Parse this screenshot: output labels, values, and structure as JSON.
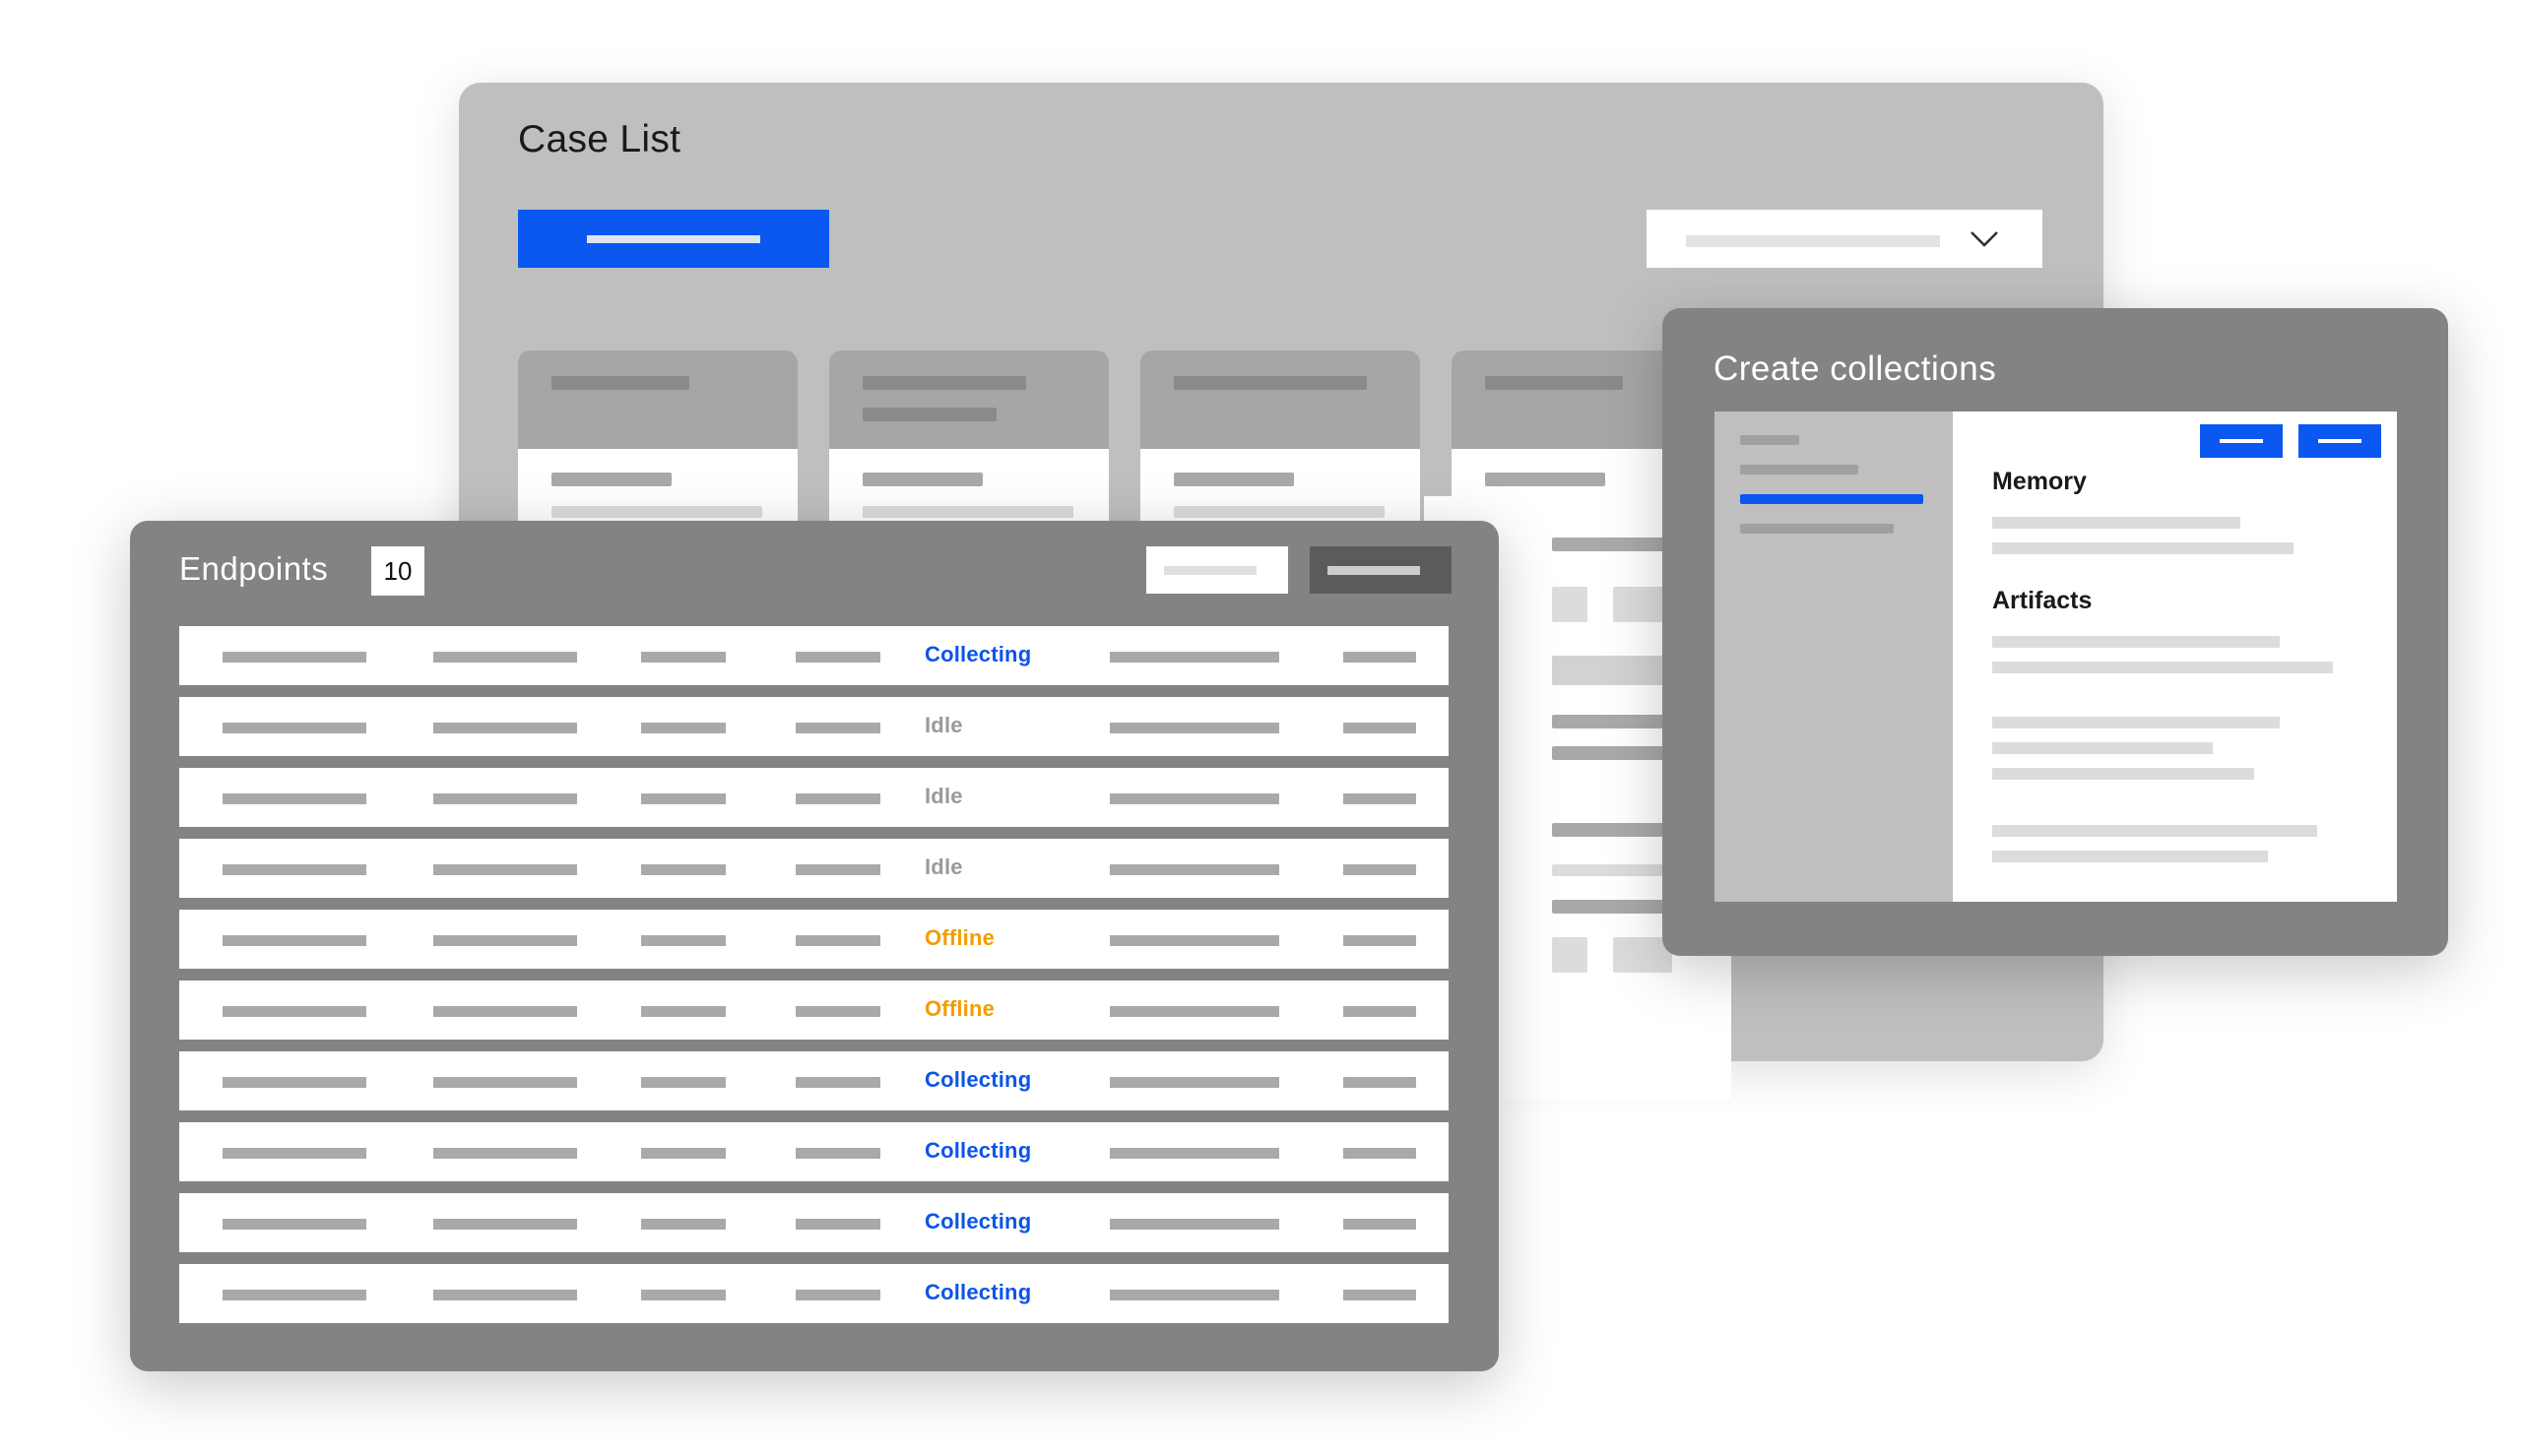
{
  "case_list": {
    "title": "Case List"
  },
  "endpoints": {
    "title": "Endpoints",
    "count": "10",
    "rows": [
      {
        "status": "Collecting",
        "state": "collecting"
      },
      {
        "status": "Idle",
        "state": "idle"
      },
      {
        "status": "Idle",
        "state": "idle"
      },
      {
        "status": "Idle",
        "state": "idle"
      },
      {
        "status": "Offline",
        "state": "offline"
      },
      {
        "status": "Offline",
        "state": "offline"
      },
      {
        "status": "Collecting",
        "state": "collecting"
      },
      {
        "status": "Collecting",
        "state": "collecting"
      },
      {
        "status": "Collecting",
        "state": "collecting"
      },
      {
        "status": "Collecting",
        "state": "collecting"
      }
    ]
  },
  "collections": {
    "title": "Create collections",
    "sections": [
      "Memory",
      "Artifacts"
    ]
  },
  "colors": {
    "accent": "#0a58f0",
    "status_collecting": "#0a55e8",
    "status_idle": "#9a9a9a",
    "status_offline": "#f39c00",
    "panel_dark": "#838383",
    "panel_light": "#bfbfbf"
  },
  "icons": {
    "dropdown": "chevron-down-icon"
  }
}
